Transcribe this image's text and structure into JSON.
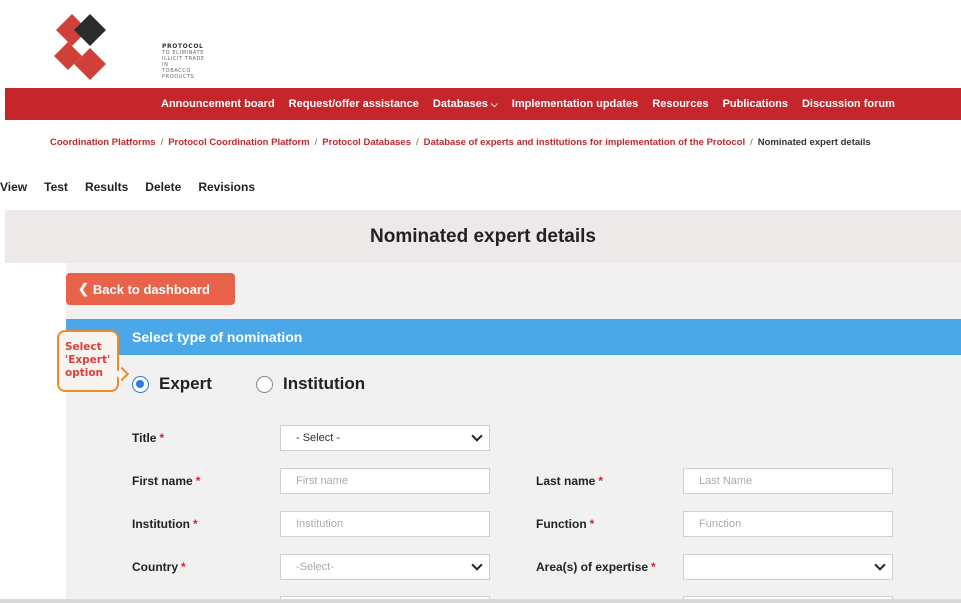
{
  "logo": {
    "icon": "fctc-protocol-diamond-logo",
    "lines": [
      "PROTOCOL",
      "TO ELIMINATE",
      "ILLICIT TRADE IN",
      "TOBACCO PRODUCTS"
    ],
    "colors": {
      "red": "#d0403a",
      "dark": "#2b2b2b"
    }
  },
  "nav": {
    "items": [
      {
        "label": "Announcement board"
      },
      {
        "label": "Request/offer assistance"
      },
      {
        "label": "Databases",
        "has_dropdown": true
      },
      {
        "label": "Implementation updates"
      },
      {
        "label": "Resources"
      },
      {
        "label": "Publications"
      },
      {
        "label": "Discussion forum"
      }
    ],
    "bg_color": "#c5262c"
  },
  "breadcrumb": {
    "items": [
      "Coordination Platforms",
      "Protocol Coordination Platform",
      "Protocol Databases",
      "Database of experts and institutions for implementation of the Protocol"
    ],
    "separator": "/",
    "current": "Nominated expert details"
  },
  "tabs": [
    "View",
    "Test",
    "Results",
    "Delete",
    "Revisions"
  ],
  "page_title": "Nominated expert details",
  "back_button": {
    "label": "Back to dashboard",
    "icon": "chevron-left-icon",
    "color": "#e8634a"
  },
  "section": {
    "title": "Select type of nomination",
    "color": "#4ba8e8"
  },
  "callout": {
    "lines": [
      "Select",
      "'Expert'",
      "option"
    ],
    "border_color": "#ee8a2c",
    "text_color": "#e03c3c"
  },
  "nomination_type": {
    "options": [
      "Expert",
      "Institution"
    ],
    "selected": "Expert"
  },
  "form": {
    "required_marker": "*",
    "title": {
      "label": "Title",
      "value": "- Select -"
    },
    "first_name": {
      "label": "First name",
      "placeholder": "First name"
    },
    "last_name": {
      "label": "Last name",
      "placeholder": "Last Name"
    },
    "institution": {
      "label": "Institution",
      "placeholder": "Institution"
    },
    "function": {
      "label": "Function",
      "placeholder": "Function"
    },
    "country": {
      "label": "Country",
      "value": "-Select-"
    },
    "expertise": {
      "label": "Area(s) of expertise",
      "value": ""
    }
  }
}
